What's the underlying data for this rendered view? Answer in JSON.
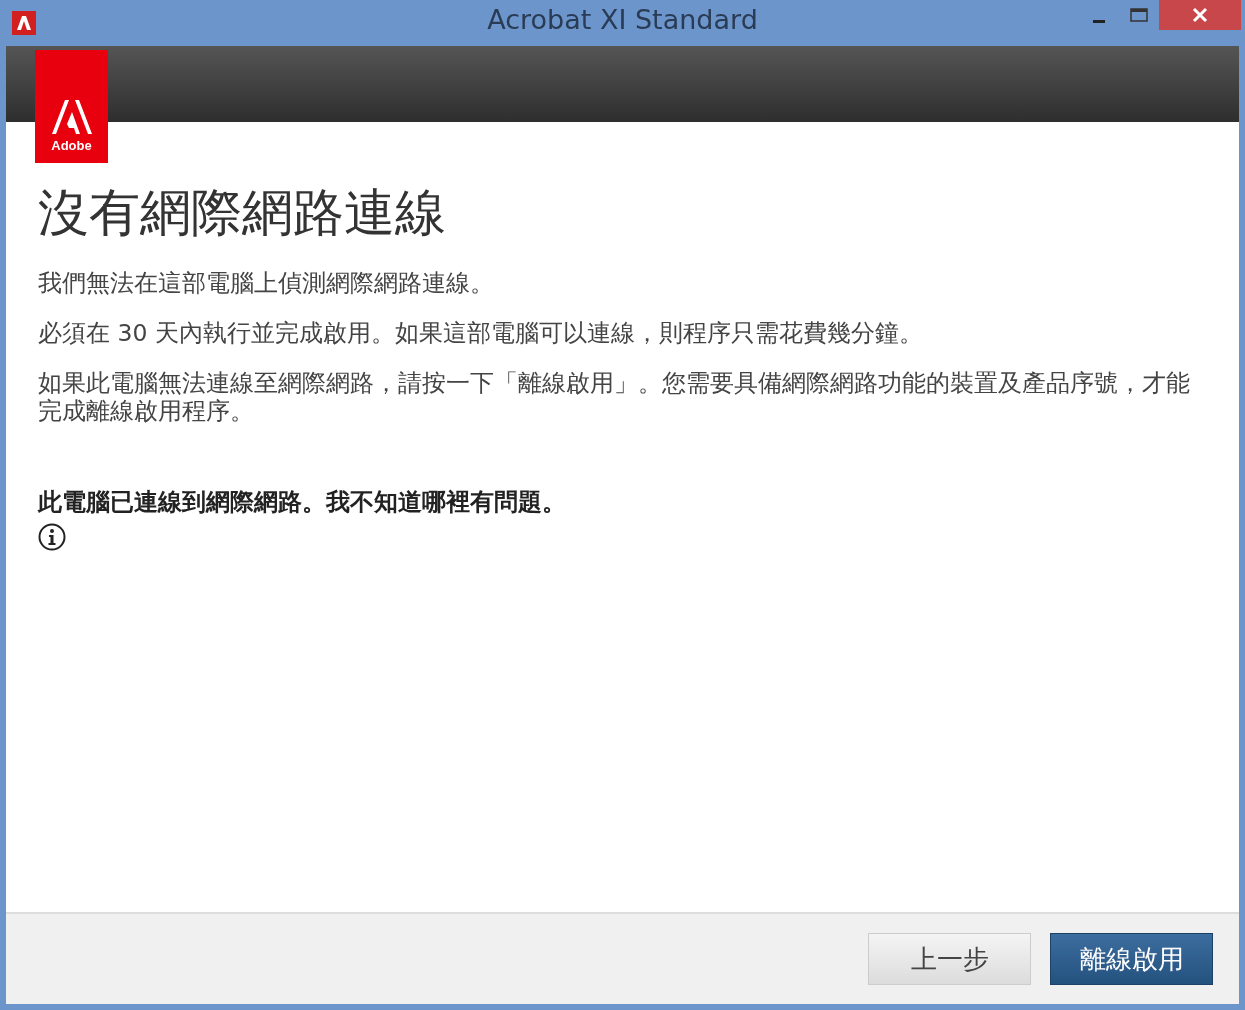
{
  "window": {
    "title": "Acrobat XI Standard"
  },
  "logo": {
    "text": "Adobe"
  },
  "heading": "沒有網際網路連線",
  "paragraphs": [
    "我們無法在這部電腦上偵測網際網路連線。",
    "必須在 30 天內執行並完成啟用。如果這部電腦可以連線，則程序只需花費幾分鐘。",
    "如果此電腦無法連線至網際網路，請按一下「離線啟用」。您需要具備網際網路功能的裝置及產品序號，才能完成離線啟用程序。"
  ],
  "note": "此電腦已連線到網際網路。我不知道哪裡有問題。",
  "buttons": [
    {
      "label": "上一步",
      "kind": "secondary"
    },
    {
      "label": "離線啟用",
      "kind": "primary"
    }
  ]
}
